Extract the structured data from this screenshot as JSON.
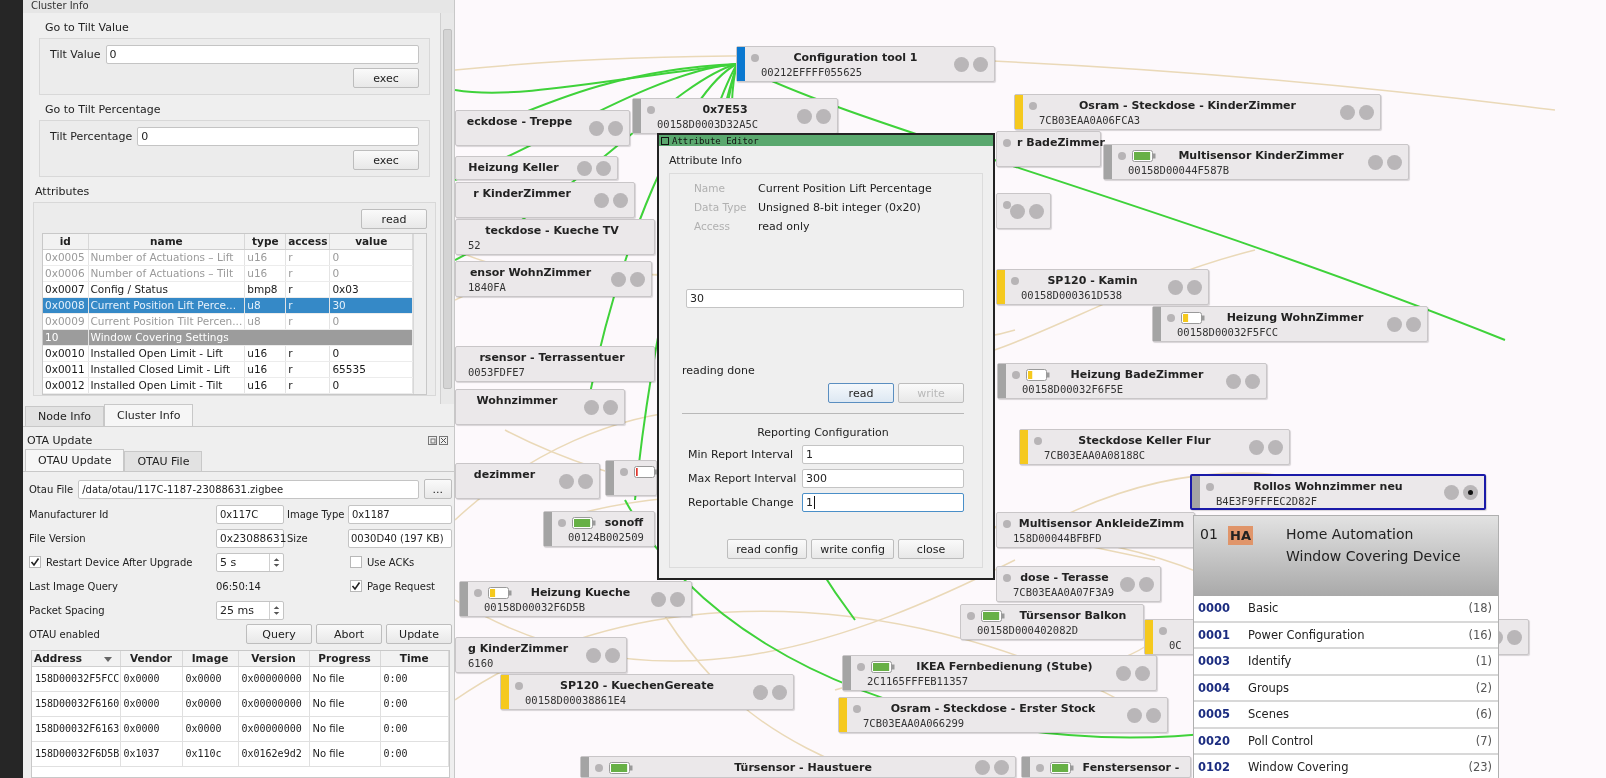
{
  "cluster_panel": {
    "title": "Cluster Info",
    "commands": [
      {
        "title": "Go to Tilt Value",
        "label": "Tilt Value",
        "value": "0",
        "button": "exec"
      },
      {
        "title": "Go to Tilt Percentage",
        "label": "Tilt Percentage",
        "value": "0",
        "button": "exec"
      }
    ],
    "attributes": {
      "title": "Attributes",
      "read_button": "read",
      "columns": [
        "id",
        "name",
        "type",
        "access",
        "value"
      ],
      "rows": [
        {
          "kind": "attribute",
          "id": "0x0005",
          "name": "Number of Actuations – Lift",
          "type": "u16",
          "access": "r",
          "value": "0",
          "available": false,
          "selected": false
        },
        {
          "kind": "attribute",
          "id": "0x0006",
          "name": "Number of Actuations – Tilt",
          "type": "u16",
          "access": "r",
          "value": "0",
          "available": false,
          "selected": false
        },
        {
          "kind": "attribute",
          "id": "0x0007",
          "name": "Config / Status",
          "type": "bmp8",
          "access": "r",
          "value": "0x03",
          "available": true,
          "selected": false
        },
        {
          "kind": "attribute",
          "id": "0x0008",
          "name": "Current Position Lift Perce...",
          "type": "u8",
          "access": "r",
          "value": "30",
          "available": true,
          "selected": true
        },
        {
          "kind": "attribute",
          "id": "0x0009",
          "name": "Current Position Tilt Percen...",
          "type": "u8",
          "access": "r",
          "value": "0",
          "available": false,
          "selected": false
        },
        {
          "kind": "section",
          "id": "10",
          "name": "Window Covering Settings"
        },
        {
          "kind": "attribute",
          "id": "0x0010",
          "name": "Installed Open Limit - Lift",
          "type": "u16",
          "access": "r",
          "value": "0",
          "available": true,
          "selected": false
        },
        {
          "kind": "attribute",
          "id": "0x0011",
          "name": "Installed Closed Limit - Lift",
          "type": "u16",
          "access": "r",
          "value": "65535",
          "available": true,
          "selected": false
        },
        {
          "kind": "attribute",
          "id": "0x0012",
          "name": "Installed Open Limit - Tilt",
          "type": "u16",
          "access": "r",
          "value": "0",
          "available": true,
          "selected": false
        }
      ]
    }
  },
  "panel_tabs": [
    {
      "label": "Node Info",
      "selected": false
    },
    {
      "label": "Cluster Info",
      "selected": true
    }
  ],
  "ota": {
    "title": "OTA Update",
    "tabs": [
      {
        "label": "OTAU Update",
        "selected": true
      },
      {
        "label": "OTAU File",
        "selected": false
      }
    ],
    "otau_file_label": "Otau File",
    "otau_file": "/data/otau/117C-1187-23088631.zigbee",
    "browse_button": "...",
    "manufacturer_label": "Manufacturer Id",
    "manufacturer": "0x117C",
    "image_type_label": "Image Type",
    "image_type": "0x1187",
    "file_version_label": "File Version",
    "file_version": "0x23088631",
    "size_label": "Size",
    "size": "0030D40 (197 KB)",
    "restart": {
      "label": "Restart Device After Upgrade",
      "checked": true,
      "value": "5 s"
    },
    "use_acks": {
      "label": "Use ACKs",
      "checked": false
    },
    "last_query_label": "Last Image Query",
    "last_query": "06:50:14",
    "page_request": {
      "label": "Page Request",
      "checked": true
    },
    "spacing_label": "Packet Spacing",
    "spacing": "25 ms",
    "status": "OTAU enabled",
    "buttons": [
      "Query",
      "Abort",
      "Update"
    ],
    "columns": [
      "Address",
      "Vendor",
      "Image",
      "Version",
      "Progress",
      "Time"
    ],
    "rows": [
      [
        "158D00032F5FCC",
        "0x0000",
        "0x0000",
        "0x00000000",
        "No file",
        "0:00"
      ],
      [
        "158D00032F6160",
        "0x0000",
        "0x0000",
        "0x00000000",
        "No file",
        "0:00"
      ],
      [
        "158D00032F6163",
        "0x0000",
        "0x0000",
        "0x00000000",
        "No file",
        "0:00"
      ],
      [
        "158D00032F6D5B",
        "0x1037",
        "0x110c",
        "0x0162e9d2",
        "No file",
        "0:00"
      ]
    ]
  },
  "canvas": {
    "nodes": [
      {
        "name": "Configuration tool 1",
        "address": "00212EFFFF055625",
        "color": "#0a78d0",
        "selected": false
      },
      {
        "name": "eckdose - Treppe",
        "selected": false
      },
      {
        "name": "0x7E53",
        "address": "00158D0003D32A5C",
        "color": "#a4a4a4",
        "selected": false
      },
      {
        "name": "Osram - Steckdose - KinderZimmer",
        "address": "7CB03EAA0A06FCA3",
        "color": "#f5c91e",
        "selected": false
      },
      {
        "name": "Heizung Keller",
        "selected": false
      },
      {
        "name": "r BadeZimmer",
        "selected": false
      },
      {
        "name": "Multisensor KinderZimmer",
        "address": "00158D00044F587B",
        "color": "#a4a4a4",
        "battery": {
          "level": 0.95
        },
        "selected": false
      },
      {
        "name": "r KinderZimmer",
        "selected": false
      },
      {
        "name": "teckdose - Kueche TV",
        "address": "52",
        "selected": false
      },
      {
        "selected": false
      },
      {
        "name": "ensor WohnZimmer",
        "address": "1840FA",
        "selected": false
      },
      {
        "name": "SP120 - Kamin",
        "address": "00158D000361D538",
        "color": "#f5c91e",
        "selected": false
      },
      {
        "name": "Heizung WohnZimmer",
        "address": "00158D00032F5FCC",
        "color": "#a4a4a4",
        "battery": {
          "level": 0.3
        },
        "selected": false
      },
      {
        "name": "rsensor - Terrassentuer",
        "address": "0053FDFE7",
        "selected": false
      },
      {
        "name": "Wohnzimmer",
        "selected": false
      },
      {
        "name": "Heizung BadeZimmer",
        "address": "00158D00032F6F5E",
        "color": "#a4a4a4",
        "battery": {
          "level": 0.25
        },
        "selected": false
      },
      {
        "name": "dezimmer",
        "selected": false
      },
      {
        "color": "#a4a4a4",
        "battery": {
          "level": 0.1
        },
        "selected": false
      },
      {
        "name": "Steckdose Keller Flur",
        "address": "7CB03EAA0A08188C",
        "color": "#f5c91e",
        "selected": false
      },
      {
        "name": "Rollos Wohnzimmer neu",
        "address": "B4E3F9FFFEC2D82F",
        "color": "#a4a4a4",
        "selected": true
      },
      {
        "name": "sonoff",
        "address": "00124B002509",
        "color": "#a4a4a4",
        "battery": {
          "level": 0.95
        },
        "selected": false
      },
      {
        "name": "Multisensor AnkleideZimm",
        "address": "158D00044BFBFD",
        "selected": false
      },
      {
        "name": "Heizung Kueche",
        "address": "00158D00032F6D5B",
        "color": "#a4a4a4",
        "battery": {
          "level": 0.3
        },
        "selected": false
      },
      {
        "name": "dose - Terasse",
        "address": "7CB03EAA0A07F3A9",
        "selected": false
      },
      {
        "name": "g KinderZimmer",
        "address": "6160",
        "selected": false
      },
      {
        "name": "Türsensor Balkon",
        "address": "00158D000402082D",
        "battery": {
          "level": 0.95
        },
        "selected": false
      },
      {
        "address": "0C",
        "color": "#f5c91e",
        "selected": false
      },
      {
        "name": "SP120 - KuechenGereate",
        "address": "00158D00038861E4",
        "color": "#f5c91e",
        "selected": false
      },
      {
        "name": "IKEA Fernbedienung (Stube)",
        "address": "2C1165FFFEB11357",
        "color": "#a4a4a4",
        "battery": {
          "level": 0.95
        },
        "selected": false
      },
      {
        "name": "Osram - Steckdose - Erster Stock",
        "address": "7CB03EAA0A066299",
        "color": "#f5c91e",
        "selected": false
      },
      {
        "name": "Türsensor - Haustuere",
        "color": "#a4a4a4",
        "battery": {
          "level": 0.95
        },
        "selected": false
      },
      {
        "name": "Fenstersensor -",
        "color": "#a4a4a4",
        "battery": {
          "level": 0.95
        },
        "selected": false
      }
    ]
  },
  "attribute_editor": {
    "title": "Attribute Editor",
    "section": "Attribute Info",
    "info": [
      {
        "label": "Name",
        "value": "Current Position Lift Percentage"
      },
      {
        "label": "Data Type",
        "value": "Unsigned 8-bit integer (0x20)"
      },
      {
        "label": "Access",
        "value": "read only"
      }
    ],
    "value": "30",
    "status": "reading done",
    "buttons": [
      {
        "label": "read",
        "disabled": false
      },
      {
        "label": "write",
        "disabled": true
      }
    ],
    "reporting": {
      "title": "Reporting Configuration",
      "fields": [
        {
          "label": "Min Report Interval",
          "value": "1",
          "focused": false
        },
        {
          "label": "Max Report Interval",
          "value": "300",
          "focused": false
        },
        {
          "label": "Reportable Change",
          "value": "1",
          "focused": true
        }
      ]
    },
    "footer_buttons": [
      "read config",
      "write config",
      "close"
    ]
  },
  "cluster_popup": {
    "endpoint": "01",
    "profile_badge": "HA",
    "profile": "Home Automation",
    "device": "Window Covering Device",
    "clusters": [
      {
        "id": "0000",
        "name": "Basic",
        "count": "(18)"
      },
      {
        "id": "0001",
        "name": "Power Configuration",
        "count": "(16)"
      },
      {
        "id": "0003",
        "name": "Identify",
        "count": "(1)"
      },
      {
        "id": "0004",
        "name": "Groups",
        "count": "(2)"
      },
      {
        "id": "0005",
        "name": "Scenes",
        "count": "(6)"
      },
      {
        "id": "0020",
        "name": "Poll Control",
        "count": "(7)"
      },
      {
        "id": "0102",
        "name": "Window Covering",
        "count": "(23)"
      }
    ]
  }
}
